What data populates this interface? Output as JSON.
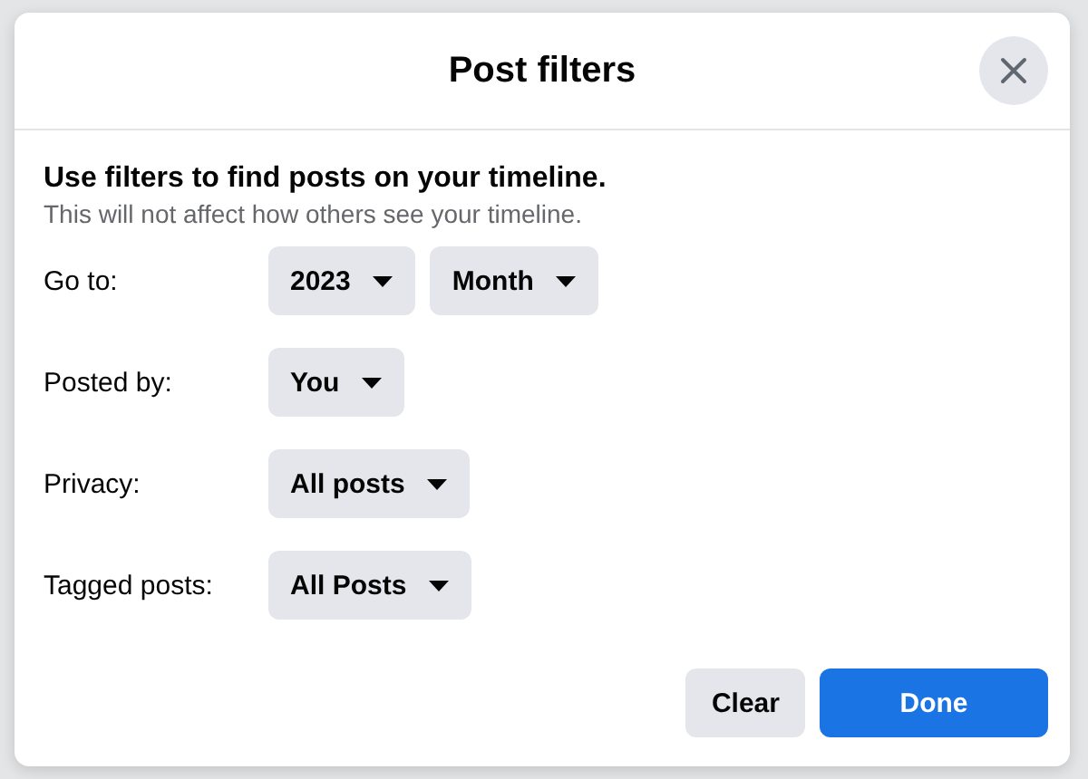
{
  "dialog": {
    "title": "Post filters",
    "heading": "Use filters to find posts on your timeline.",
    "subheading": "This will not affect how others see your timeline.",
    "filters": [
      {
        "label": "Go to:",
        "dropdowns": [
          "2023",
          "Month"
        ]
      },
      {
        "label": "Posted by:",
        "dropdowns": [
          "You"
        ]
      },
      {
        "label": "Privacy:",
        "dropdowns": [
          "All posts"
        ]
      },
      {
        "label": "Tagged posts:",
        "dropdowns": [
          "All Posts"
        ]
      }
    ],
    "buttons": [
      {
        "label": "Clear",
        "kind": "secondary"
      },
      {
        "label": "Done",
        "kind": "primary"
      }
    ]
  }
}
